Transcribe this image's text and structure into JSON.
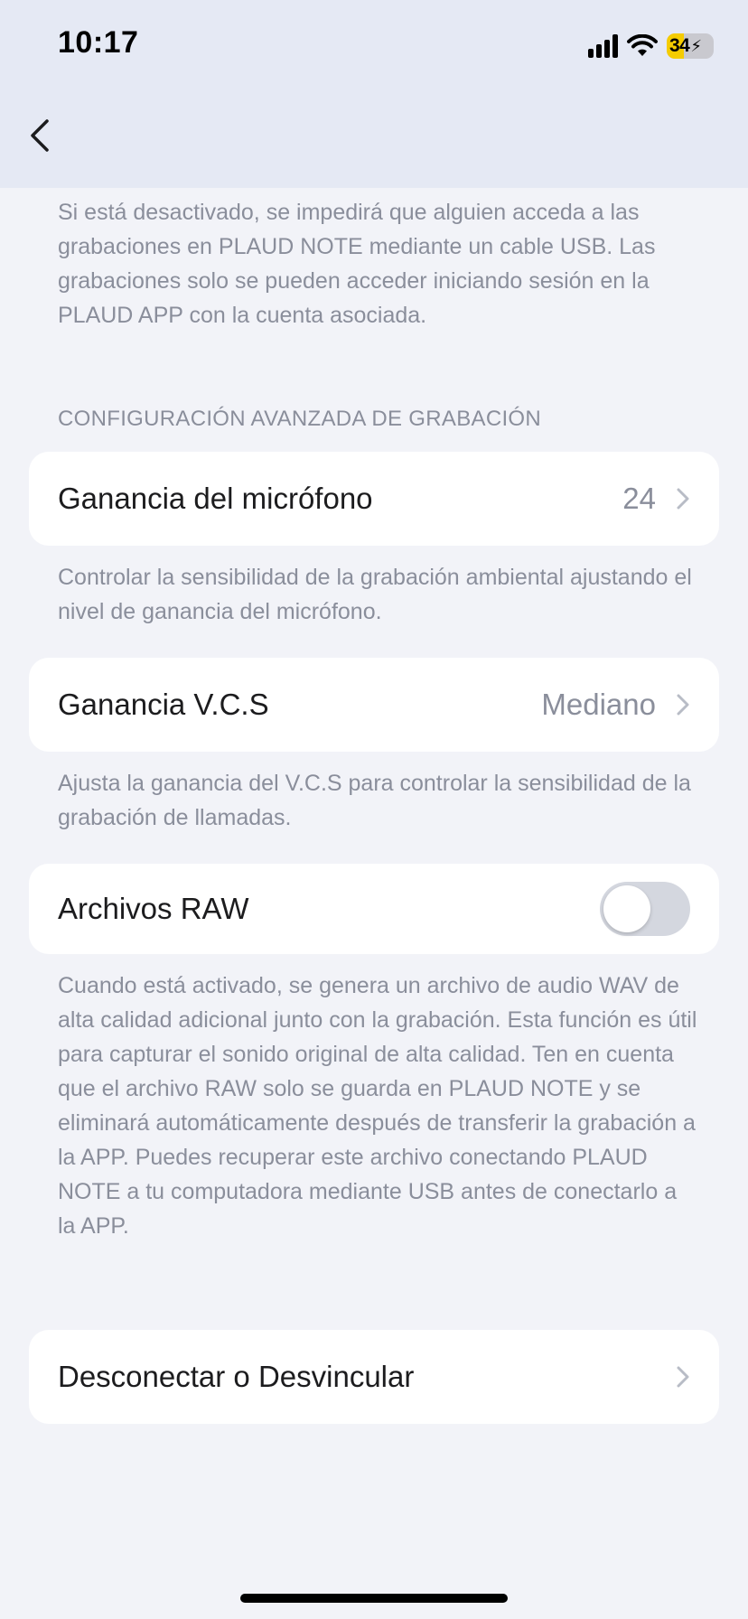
{
  "status_bar": {
    "time": "10:17",
    "battery_level": "34",
    "icons": [
      "cellular-signal-icon",
      "wifi-icon",
      "battery-charging-icon"
    ]
  },
  "nav": {
    "back_icon": "chevron-left-icon"
  },
  "usb_description": "Si está desactivado, se impedirá que alguien acceda a las grabaciones en PLAUD NOTE mediante un cable USB. Las grabaciones solo se pueden acceder iniciando sesión en la PLAUD APP con la cuenta asociada.",
  "advanced_section": {
    "header": "CONFIGURACIÓN AVANZADA DE GRABACIÓN",
    "mic_gain": {
      "label": "Ganancia del micrófono",
      "value": "24",
      "description": "Controlar la sensibilidad de la grabación ambiental ajustando el nivel de ganancia del micrófono."
    },
    "vcs_gain": {
      "label": "Ganancia V.C.S",
      "value": "Mediano",
      "description": "Ajusta la ganancia del V.C.S para controlar la sensibilidad de la grabación de llamadas."
    },
    "raw_files": {
      "label": "Archivos RAW",
      "enabled": false,
      "description": "Cuando está activado, se genera un archivo de audio WAV de alta calidad adicional junto con la grabación. Esta función es útil para capturar el sonido original de alta calidad. Ten en cuenta que el archivo RAW solo se guarda en PLAUD NOTE y se eliminará automáticamente después de transferir la grabación a la APP. Puedes recuperar este archivo conectando PLAUD NOTE a tu computadora mediante USB antes de conectarlo a la APP."
    }
  },
  "disconnect": {
    "label": "Desconectar o Desvincular"
  },
  "colors": {
    "background": "#f2f3f8",
    "header_background": "#e5e9f4",
    "card": "#ffffff",
    "secondary_text": "#8a8e9b",
    "toggle_off": "#d4d7df",
    "battery_fill": "#f5cc00"
  }
}
